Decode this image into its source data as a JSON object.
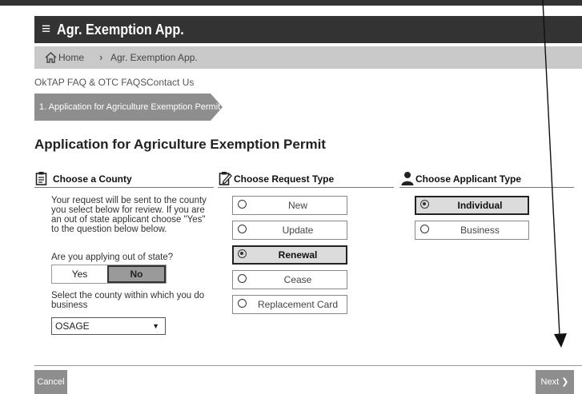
{
  "header": {
    "menu_icon": "≡",
    "title": "Agr. Exemption App."
  },
  "breadcrumb": {
    "home": "Home",
    "separator": "›",
    "current": "Agr. Exemption App."
  },
  "links": {
    "faq": "OkTAP FAQ & OTC FAQS",
    "contact": "Contact Us"
  },
  "step": {
    "label": "1. Application for Agriculture Exemption Permit"
  },
  "page_title": "Application for Agriculture Exemption Permit",
  "county": {
    "heading": "Choose a County",
    "description": "Your request will be sent to the county you select below for review. If you are an out of state applicant choose \"Yes\" to the question below below.",
    "out_of_state_question": "Are you applying out of state?",
    "yes": "Yes",
    "no": "No",
    "selected": "No",
    "county_question": "Select the county within which you do business",
    "county_value": "OSAGE",
    "caret": "▼"
  },
  "request_type": {
    "heading": "Choose Request Type",
    "options": [
      "New",
      "Update",
      "Renewal",
      "Cease",
      "Replacement Card"
    ],
    "selected": "Renewal"
  },
  "applicant_type": {
    "heading": "Choose Applicant Type",
    "options": [
      "Individual",
      "Business"
    ],
    "selected": "Individual"
  },
  "footer": {
    "cancel": "Cancel",
    "next": "Next ❯"
  },
  "icons": [
    "menu-icon",
    "home-icon",
    "clipboard-icon",
    "edit-icon",
    "person-icon",
    "annotation-arrow"
  ]
}
